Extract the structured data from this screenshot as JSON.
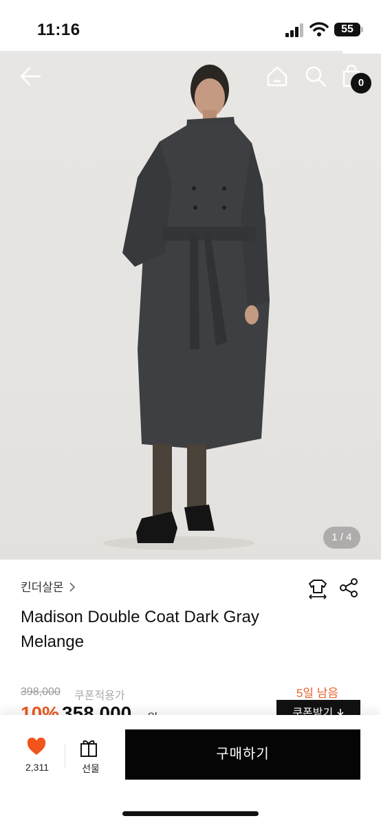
{
  "status_bar": {
    "time": "11:16",
    "battery": "55"
  },
  "header": {
    "cart_count": "0"
  },
  "gallery": {
    "page_indicator": "1 / 4"
  },
  "product": {
    "brand": "킨더살몬",
    "title": "Madison Double Coat Dark Gray Melange",
    "original_price": "398,000",
    "coupon_label": "쿠폰적용가",
    "days_left": "5일 남음",
    "discount": "10%",
    "sale_price": "358,000",
    "currency": "원",
    "coupon_button": "쿠폰받기"
  },
  "bottom_bar": {
    "like_count": "2,311",
    "gift_label": "선물",
    "buy_label": "구매하기"
  },
  "colors": {
    "accent": "#ee5a24",
    "like": "#f2541b",
    "dark": "#111111"
  },
  "icons": [
    "back-arrow-icon",
    "home-icon",
    "search-icon",
    "shopping-bag-icon",
    "size-guide-icon",
    "share-icon",
    "heart-icon",
    "gift-icon",
    "chevron-right-icon",
    "chevron-down-icon"
  ]
}
